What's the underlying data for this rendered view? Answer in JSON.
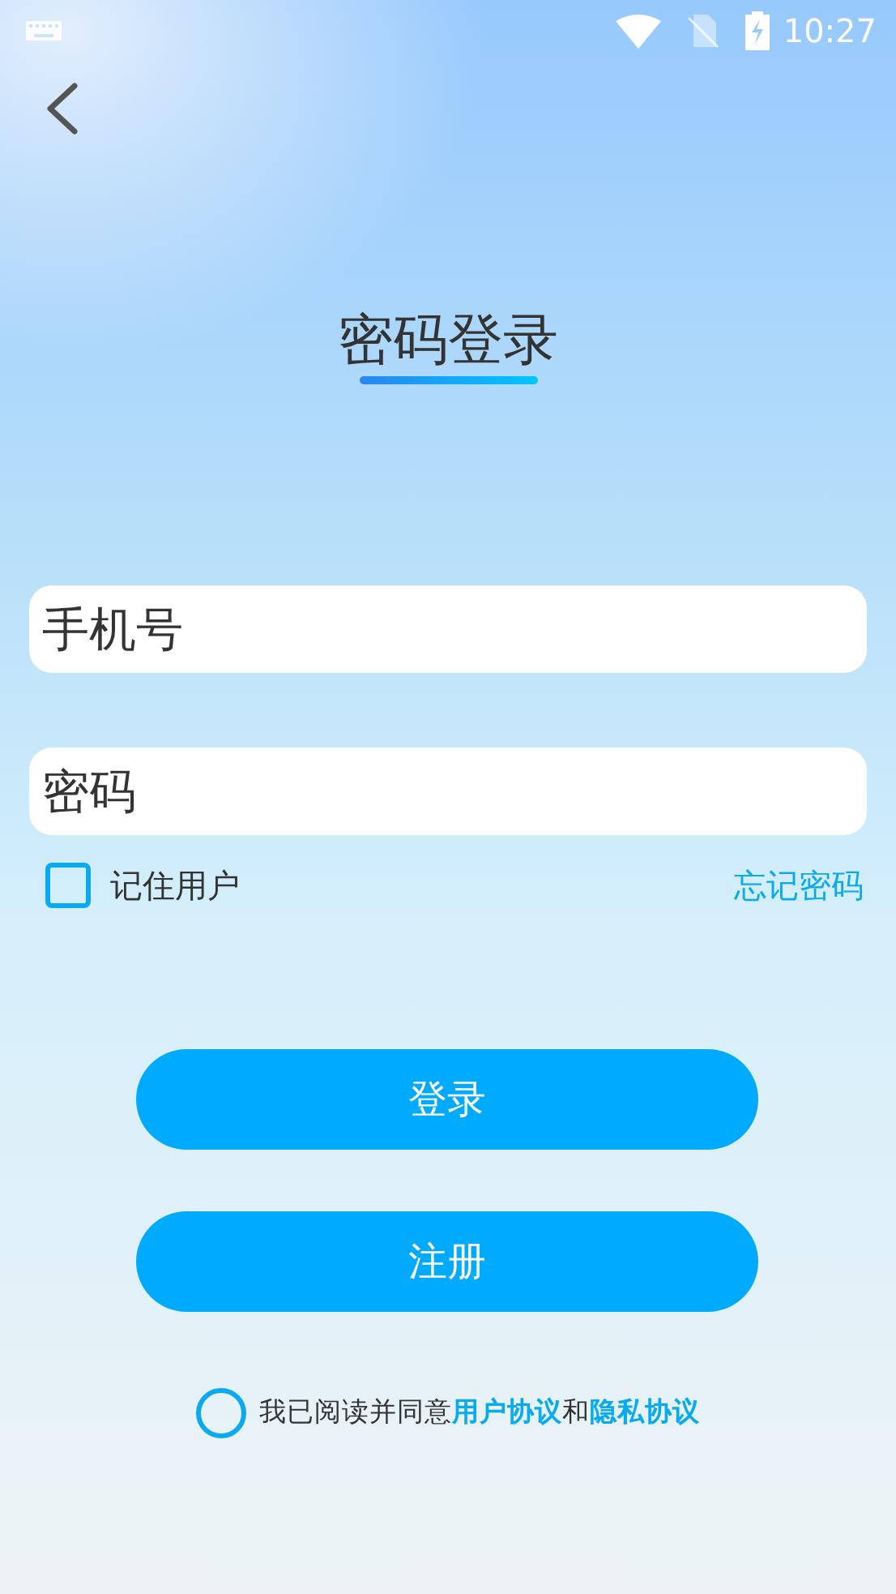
{
  "status_bar": {
    "time": "10:27"
  },
  "title": "密码登录",
  "fields": [
    {
      "placeholder": "手机号"
    },
    {
      "placeholder": "密码"
    }
  ],
  "remember": {
    "label": "记住用户",
    "checked": false
  },
  "forgot_link": "忘记密码",
  "buttons": [
    "登录",
    "注册"
  ],
  "agreement": {
    "checked": false,
    "parts": [
      {
        "kind": "text",
        "text": "我已阅读并同意"
      },
      {
        "kind": "link",
        "text": "用户协议"
      },
      {
        "kind": "text",
        "text": "和"
      },
      {
        "kind": "link",
        "text": "隐私协议"
      }
    ]
  }
}
